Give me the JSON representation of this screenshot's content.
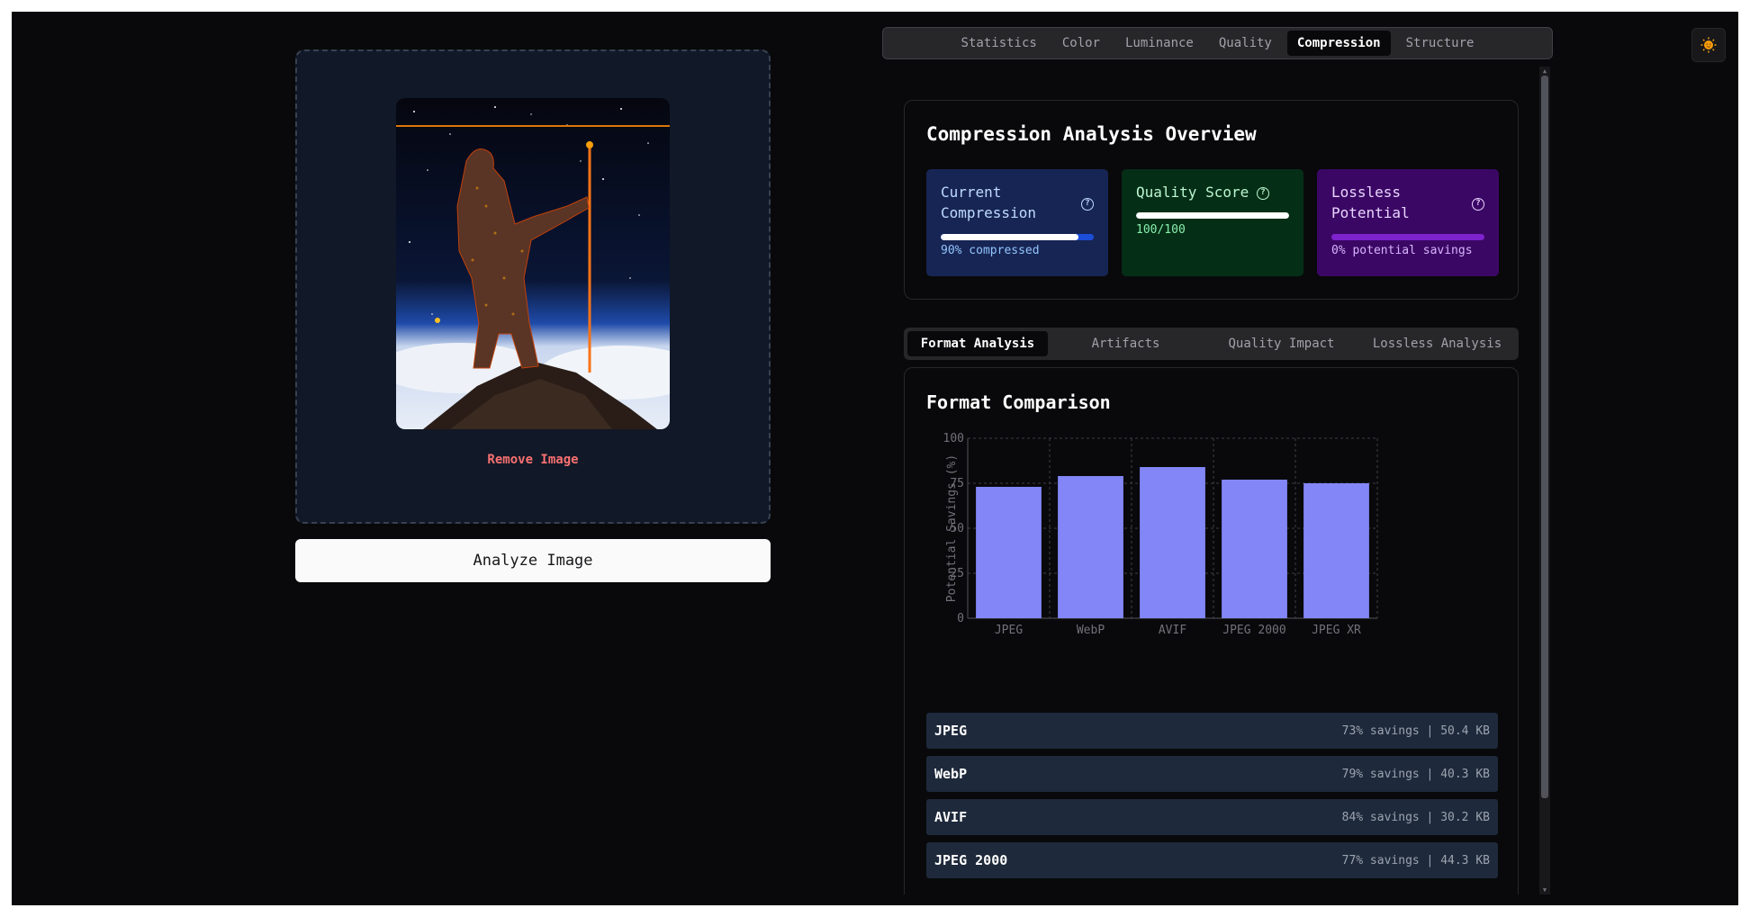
{
  "upload": {
    "remove_label": "Remove Image",
    "analyze_label": "Analyze Image"
  },
  "main_tabs": [
    {
      "label": "Statistics"
    },
    {
      "label": "Color"
    },
    {
      "label": "Luminance"
    },
    {
      "label": "Quality"
    },
    {
      "label": "Compression",
      "active": true
    },
    {
      "label": "Structure"
    }
  ],
  "overview": {
    "title": "Compression Analysis Overview",
    "metrics": {
      "compression": {
        "label_line1": "Current",
        "label_line2": "Compression",
        "percent": 90,
        "sub": "90% compressed",
        "color": "#172554"
      },
      "quality": {
        "label": "Quality Score",
        "percent": 100,
        "sub": "100/100",
        "color": "#052e16"
      },
      "lossless": {
        "label_line1": "Lossless",
        "label_line2": "Potential",
        "percent": 0,
        "sub": "0% potential savings",
        "color": "#3b0764"
      }
    }
  },
  "sub_tabs": [
    {
      "label": "Format Analysis",
      "active": true
    },
    {
      "label": "Artifacts"
    },
    {
      "label": "Quality Impact"
    },
    {
      "label": "Lossless Analysis"
    }
  ],
  "format_section": {
    "title": "Format Comparison"
  },
  "chart_data": {
    "type": "bar",
    "categories": [
      "JPEG",
      "WebP",
      "AVIF",
      "JPEG 2000",
      "JPEG XR"
    ],
    "values": [
      73,
      79,
      84,
      77,
      75
    ],
    "ylabel": "Potential Savings (%)",
    "yticks": [
      "0",
      "25",
      "50",
      "75",
      "100"
    ],
    "ylim": [
      0,
      100
    ],
    "grid": true,
    "bar_color": "#8286f6"
  },
  "formats": [
    {
      "name": "JPEG",
      "detail": "73% savings | 50.4 KB"
    },
    {
      "name": "WebP",
      "detail": "79% savings | 40.3 KB"
    },
    {
      "name": "AVIF",
      "detail": "84% savings | 30.2 KB"
    },
    {
      "name": "JPEG 2000",
      "detail": "77% savings | 44.3 KB"
    }
  ]
}
